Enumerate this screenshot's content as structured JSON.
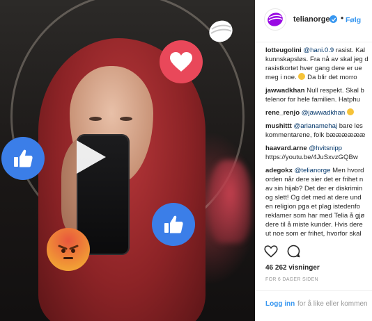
{
  "post": {
    "account": {
      "username": "telianorge",
      "dot": "•",
      "follow_label": "Følg",
      "verified": true
    },
    "comments": [
      {
        "user": "lotteugolini",
        "lines": [
          {
            "mention": "@hani.0.9",
            "text": " rasist. Kal"
          },
          {
            "text": "kunnskapsløs. Fra nå av skal jeg d"
          },
          {
            "text": "rasistkortet hver gang dere er ue"
          },
          {
            "text": "meg i noe. ",
            "emoji": "smile",
            "text_after": " Da blir det morro"
          }
        ]
      },
      {
        "user": "jawwadkhan",
        "lines": [
          {
            "text": " Null respekt. Skal b"
          },
          {
            "text": "telenor for hele familien. Hatphu"
          }
        ]
      },
      {
        "user": "rene_renjo",
        "lines": [
          {
            "mention": " @jawwadkhan",
            "emoji": "smile"
          }
        ]
      },
      {
        "user": "mushittt",
        "lines": [
          {
            "mention": " @arianamehaj",
            "text": " bare les"
          },
          {
            "text": "kommentarene, folk bææææææ"
          }
        ]
      },
      {
        "user": "haavard.arne",
        "lines": [
          {
            "mention": " @hvitsnipp"
          },
          {
            "text": "https://youtu.be/4JuSxvzGQBw"
          }
        ]
      },
      {
        "user": "adegokx",
        "lines": [
          {
            "mention": " @telianorge",
            "text": " Men hvord"
          },
          {
            "text": "orden når dere sier det er frihet n"
          },
          {
            "text": "av sin hijab? Det der er diskrimin"
          },
          {
            "text": "og slett! Og det med at dere und"
          },
          {
            "text": "en religion pga et plag istedenfo"
          },
          {
            "text": "reklamer som har med Telia å gjø"
          },
          {
            "text": "dere til å miste kunder. Hvis dere"
          },
          {
            "text": "ut noe som er frihet, hvorfor skal"
          }
        ]
      }
    ],
    "views": "46 262 visninger",
    "time_ago": "FOR 6 DAGER SIDEN",
    "login": {
      "link": "Logg inn",
      "rest": " for å like eller kommen"
    }
  },
  "media": {
    "icons": [
      "play-icon",
      "heart-reaction-icon",
      "like-reaction-icon",
      "angry-reaction-icon",
      "telia-logo-icon"
    ]
  },
  "colors": {
    "accent": "#3897f0",
    "telia_purple": "#990ae3",
    "heart": "#e9485a",
    "like": "#3b7ee8"
  }
}
